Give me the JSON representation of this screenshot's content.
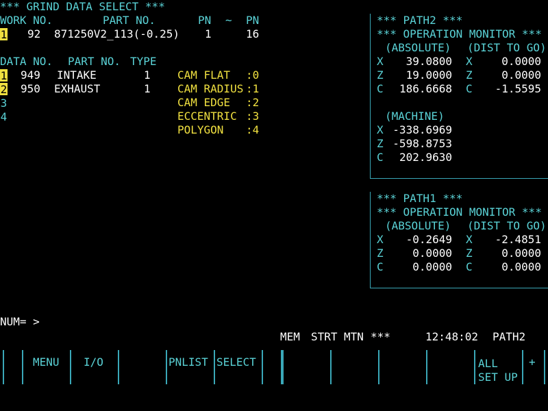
{
  "screen_title": "*** GRIND DATA SELECT ***",
  "work": {
    "headers": {
      "work_no": "WORK NO.",
      "part_no": "PART NO.",
      "pn_from": "PN",
      "tilde": "~",
      "pn_to": "PN"
    },
    "row": {
      "index": "1",
      "work_no": "92",
      "part_no": "871250V2_113(-0.25)",
      "pn_from": "1",
      "pn_to": "16"
    }
  },
  "data_table": {
    "headers": {
      "data_no": "DATA NO.",
      "part_no": "PART NO.",
      "type": "TYPE"
    },
    "rows": [
      {
        "index": "1",
        "data_no": "949",
        "part_no": "INTAKE",
        "type": "1"
      },
      {
        "index": "2",
        "data_no": "950",
        "part_no": "EXHAUST",
        "type": "1"
      },
      {
        "index": "3",
        "data_no": "",
        "part_no": "",
        "type": ""
      },
      {
        "index": "4",
        "data_no": "",
        "part_no": "",
        "type": ""
      }
    ]
  },
  "type_legend": [
    {
      "name": "CAM FLAT",
      "code": ":0"
    },
    {
      "name": "CAM RADIUS",
      "code": ":1"
    },
    {
      "name": "CAM EDGE",
      "code": ":2"
    },
    {
      "name": "ECCENTRIC",
      "code": ":3"
    },
    {
      "name": "POLYGON",
      "code": ":4"
    }
  ],
  "path2": {
    "title": "*** PATH2 ***",
    "monitor_title": "*** OPERATION MONITOR ***",
    "absolute_label": "(ABSOLUTE)",
    "dist_label": "(DIST TO GO)",
    "absolute": [
      {
        "axis": "X",
        "value": "39.0800"
      },
      {
        "axis": "Z",
        "value": "19.0000"
      },
      {
        "axis": "C",
        "value": "186.6668"
      }
    ],
    "dist": [
      {
        "axis": "X",
        "value": "0.0000"
      },
      {
        "axis": "Z",
        "value": "0.0000"
      },
      {
        "axis": "C",
        "value": "-1.5595"
      }
    ],
    "machine_label": "(MACHINE)",
    "machine": [
      {
        "axis": "X",
        "value": "-338.6969"
      },
      {
        "axis": "Z",
        "value": "-598.8753"
      },
      {
        "axis": "C",
        "value": "202.9630"
      }
    ]
  },
  "path1": {
    "title": "*** PATH1 ***",
    "monitor_title": "*** OPERATION MONITOR ***",
    "absolute_label": "(ABSOLUTE)",
    "dist_label": "(DIST TO GO)",
    "absolute": [
      {
        "axis": "X",
        "value": "-0.2649"
      },
      {
        "axis": "Z",
        "value": "0.0000"
      },
      {
        "axis": "C",
        "value": "0.0000"
      }
    ],
    "dist": [
      {
        "axis": "X",
        "value": "-2.4851"
      },
      {
        "axis": "Z",
        "value": "0.0000"
      },
      {
        "axis": "C",
        "value": "0.0000"
      }
    ]
  },
  "input_prompt": "NUM= >",
  "status_bar": {
    "mode": "MEM",
    "state": "STRT",
    "motion": "MTN",
    "alarm": "***",
    "time": "12:48:02",
    "path": "PATH2"
  },
  "softkeys": [
    "",
    "MENU",
    "I/O",
    "",
    "PNLIST",
    "SELECT",
    "",
    "",
    "",
    "",
    "",
    "ALL\nSET UP",
    "+"
  ],
  "colors": {
    "background": "#000000",
    "label_cyan": "#5ad2d6",
    "highlight_yellow": "#f0e040",
    "value_white": "#ffffff",
    "border": "#3aa8b8"
  }
}
